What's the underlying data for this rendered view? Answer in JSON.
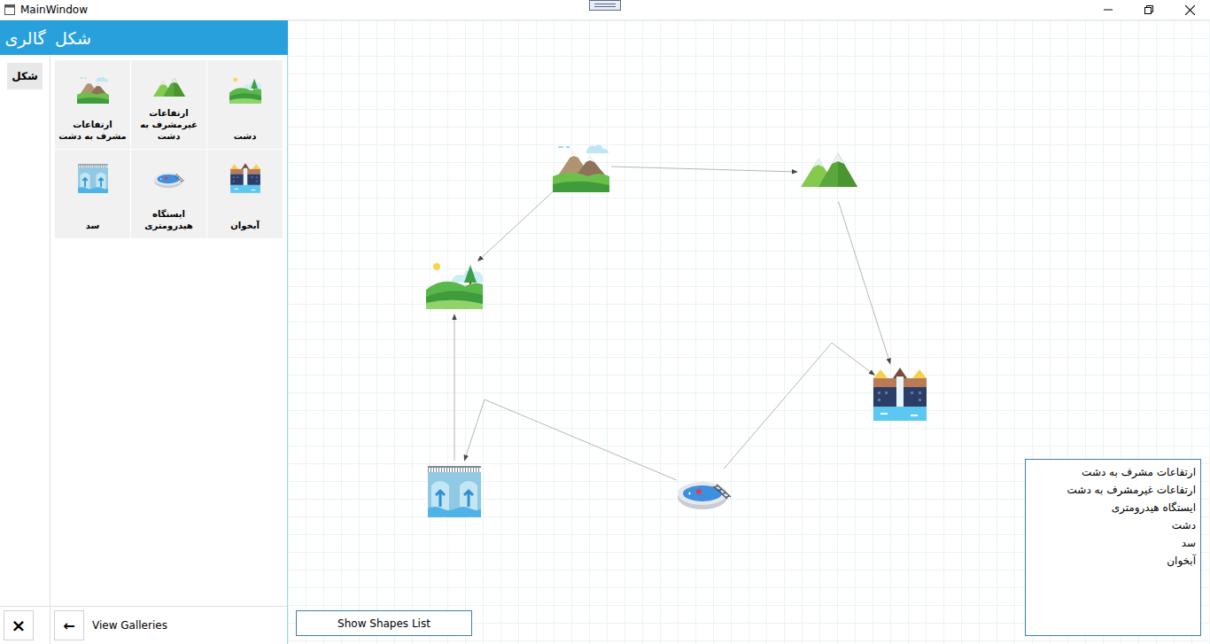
{
  "window": {
    "title": "MainWindow"
  },
  "header": {
    "tabs": [
      {
        "label": "گالری"
      },
      {
        "label": "شکل"
      }
    ]
  },
  "categories": [
    {
      "label": "شکل",
      "selected": true
    }
  ],
  "gallery": {
    "tiles": [
      {
        "label": "دشت",
        "kind": "plain"
      },
      {
        "label": "ارتفاعات غیرمشرف به دشت",
        "kind": "highland"
      },
      {
        "label": "ارتفاعات مشرف به دشت",
        "kind": "overlook"
      },
      {
        "label": "آبخوان",
        "kind": "aquifer"
      },
      {
        "label": "ایستگاه هیدرومتری",
        "kind": "station"
      },
      {
        "label": "سد",
        "kind": "dam"
      }
    ]
  },
  "footer": {
    "close": "×",
    "back": "←",
    "viewGalleries": "View Galleries"
  },
  "diagram": {
    "nodes": [
      {
        "kind": "overlook"
      },
      {
        "kind": "highland"
      },
      {
        "kind": "plain"
      },
      {
        "kind": "aquifer"
      },
      {
        "kind": "dam"
      },
      {
        "kind": "station"
      }
    ],
    "edges": [
      {
        "from": 0,
        "to": 1
      },
      {
        "from": 0,
        "to": 2
      },
      {
        "from": 1,
        "to": 3
      },
      {
        "from": 4,
        "to": 2
      },
      {
        "from": 5,
        "to": 4
      },
      {
        "from": 5,
        "to": 3
      }
    ]
  },
  "shapesButton": "Show Shapes List",
  "shapesList": [
    "ارتفاعات مشرف به دشت",
    "ارتفاعات غیرمشرف به دشت",
    "ایستگاه هیدرومتری",
    "دشت",
    "سد",
    "آبخوان"
  ]
}
